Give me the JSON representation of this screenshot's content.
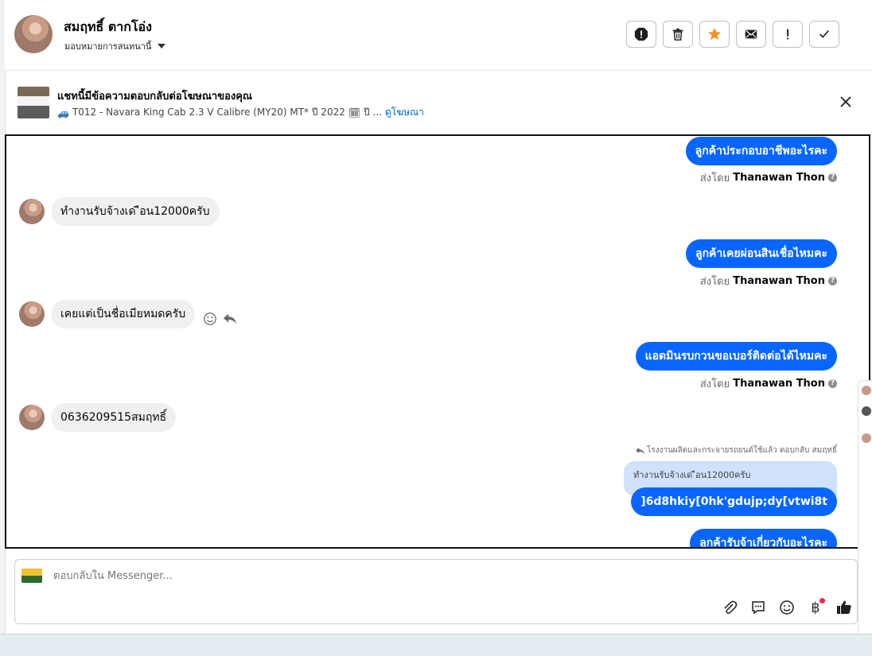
{
  "header": {
    "contact_name": "สมฤทธิ์ ตากโอ่ง",
    "assign_label": "มอบหมายการสนทนานี้",
    "actions": [
      "spam-icon",
      "trash-icon",
      "star-icon",
      "mail-icon",
      "exclamation-icon",
      "check-icon"
    ],
    "star_color": "#f7931e"
  },
  "ad": {
    "title": "แชทนี้มีข้อความตอบกลับต่อโฆษณาของคุณ",
    "subtitle_emoji": "🚙",
    "subtitle": "T012 - Navara King Cab 2.3 V Calibre (MY20) MT* ปี 2022",
    "calendar_emoji": "🗓",
    "ellipsis": "ปี ...",
    "link": "ดูโฆษณา"
  },
  "messages": {
    "out1": "ลูกค้าประกอบอาชีพอะไรคะ",
    "sent_by_prefix": "ส่งโดย",
    "sent_by_name": "Thanawan Thon",
    "in1": "ทำงานรับจ้างเด ือน12000ครับ",
    "out2": "ลูกค้าเคยผ่อนสินเชื่อไหมคะ",
    "in2": "เคยแต่เป็นชื่อเมียหมดครับ",
    "out3": "แอดมินรบกวนขอเบอร์ติดต่อได้ไหมคะ",
    "in3": "0636209515สมฤทธิ์",
    "reply_meta": "โรงงานผลิตและกระจายรถยนต์ใช้แล้ว ตอบกลับ สมฤทธิ์",
    "quoted": "ทำงานรับจ้างเด ือน12000ครับ",
    "out4": "]6d8hkiy[0hk'gdujp;dy[vtwi8t",
    "out5": "ลูกค้ารับจ้าเกี่ยวกับอะไรคะ"
  },
  "composer": {
    "placeholder": "ตอบกลับใน Messenger...",
    "baht": "฿"
  },
  "colors": {
    "bubble_out": "#0866ff",
    "bubble_in": "#f0f0f0",
    "link": "#0064d1"
  }
}
